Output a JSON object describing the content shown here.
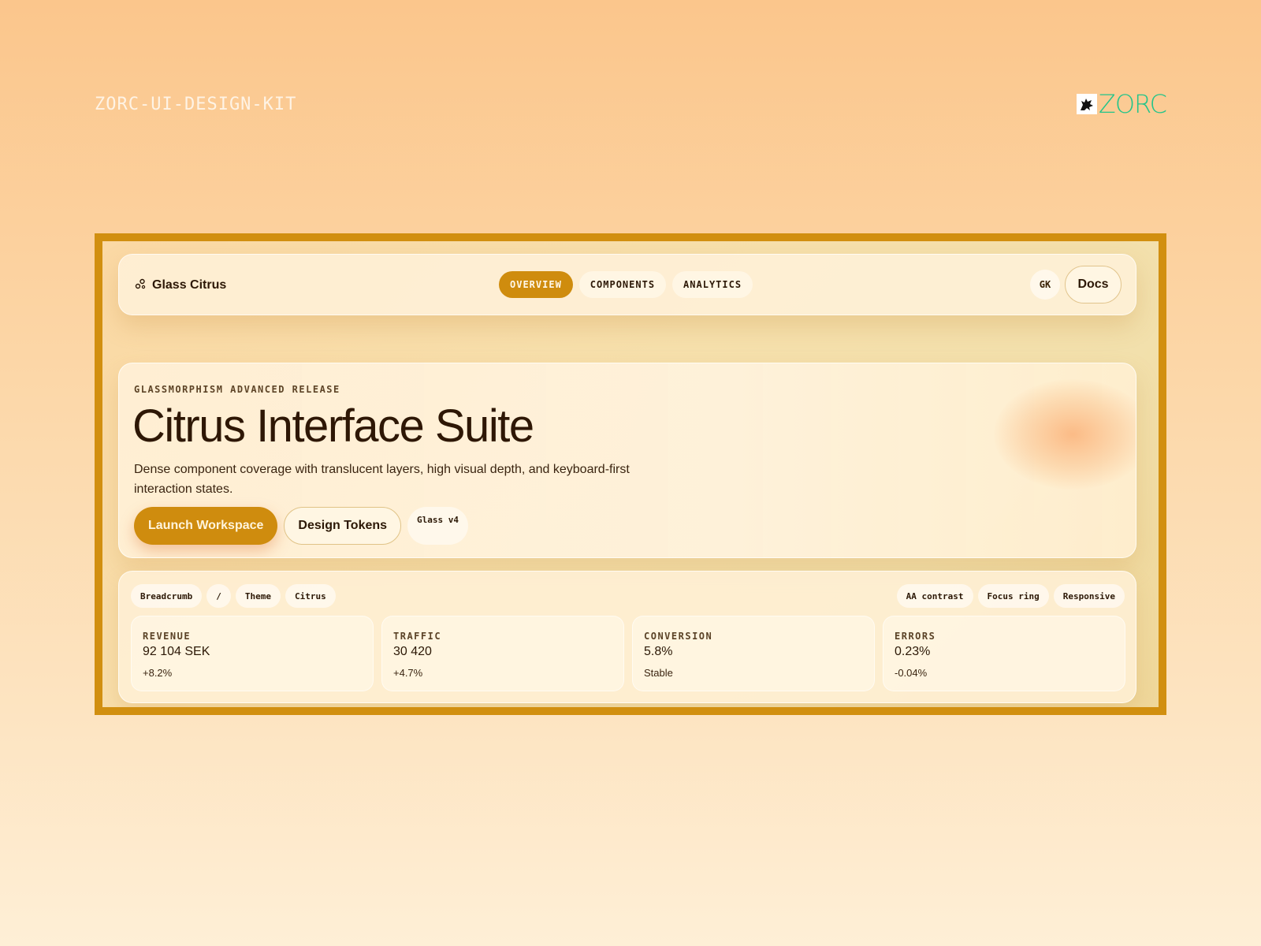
{
  "page": {
    "kit_title": "ZORC-UI-DESIGN-KIT",
    "brand_name": "ZORC",
    "brand_color": "#22c48a"
  },
  "nav": {
    "brand_label": "Glass Citrus",
    "brand_icon": "nodes-icon",
    "tabs": [
      {
        "label": "OVERVIEW",
        "active": true
      },
      {
        "label": "COMPONENTS",
        "active": false
      },
      {
        "label": "ANALYTICS",
        "active": false
      }
    ],
    "avatar_initials": "GK",
    "docs_label": "Docs"
  },
  "hero": {
    "eyebrow": "GLASSMORPHISM ADVANCED RELEASE",
    "title": "Citrus Interface Suite",
    "description": "Dense component coverage with translucent layers, high visual depth, and keyboard-first interaction states.",
    "primary_button": "Launch Workspace",
    "secondary_button": "Design Tokens",
    "badge": "Glass v4"
  },
  "panel": {
    "breadcrumb": [
      "Breadcrumb",
      "/",
      "Theme",
      "Citrus"
    ],
    "tags": [
      "AA contrast",
      "Focus ring",
      "Responsive"
    ],
    "stats": [
      {
        "label": "REVENUE",
        "value": "92 104 SEK",
        "delta": "+8.2%"
      },
      {
        "label": "TRAFFIC",
        "value": "30 420",
        "delta": "+4.7%"
      },
      {
        "label": "CONVERSION",
        "value": "5.8%",
        "delta": "Stable"
      },
      {
        "label": "ERRORS",
        "value": "0.23%",
        "delta": "-0.04%"
      }
    ]
  },
  "colors": {
    "accent": "#cf8c0e",
    "frame_border": "#d18f10",
    "text_dark": "#2c1806"
  }
}
